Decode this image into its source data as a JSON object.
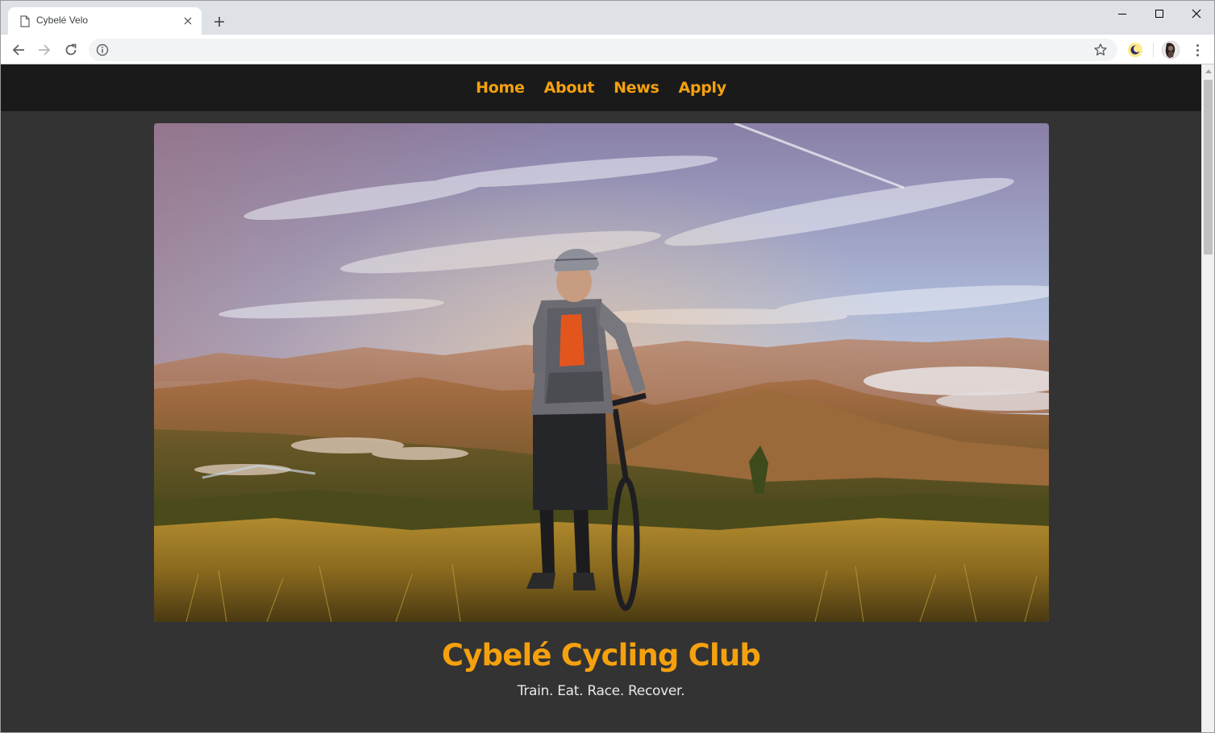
{
  "browser": {
    "tab_title": "Cybelé Velo",
    "url": "",
    "icons": {
      "tab": "document-icon",
      "close": "close-icon",
      "new_tab": "plus-icon",
      "back": "arrow-left-icon",
      "forward": "arrow-right-icon",
      "reload": "reload-icon",
      "site_info": "info-icon",
      "bookmark": "star-icon",
      "extension": "moon-icon",
      "profile": "avatar",
      "menu": "more-vert-icon"
    }
  },
  "site": {
    "nav": [
      "Home",
      "About",
      "News",
      "Apply"
    ],
    "title": "Cybelé Cycling Club",
    "tagline": "Train. Eat. Race. Recover."
  },
  "colors": {
    "accent": "#f5a10e",
    "nav_background": "#1a1a1a",
    "page_background": "#333333",
    "tagline": "#e8e8e8"
  }
}
